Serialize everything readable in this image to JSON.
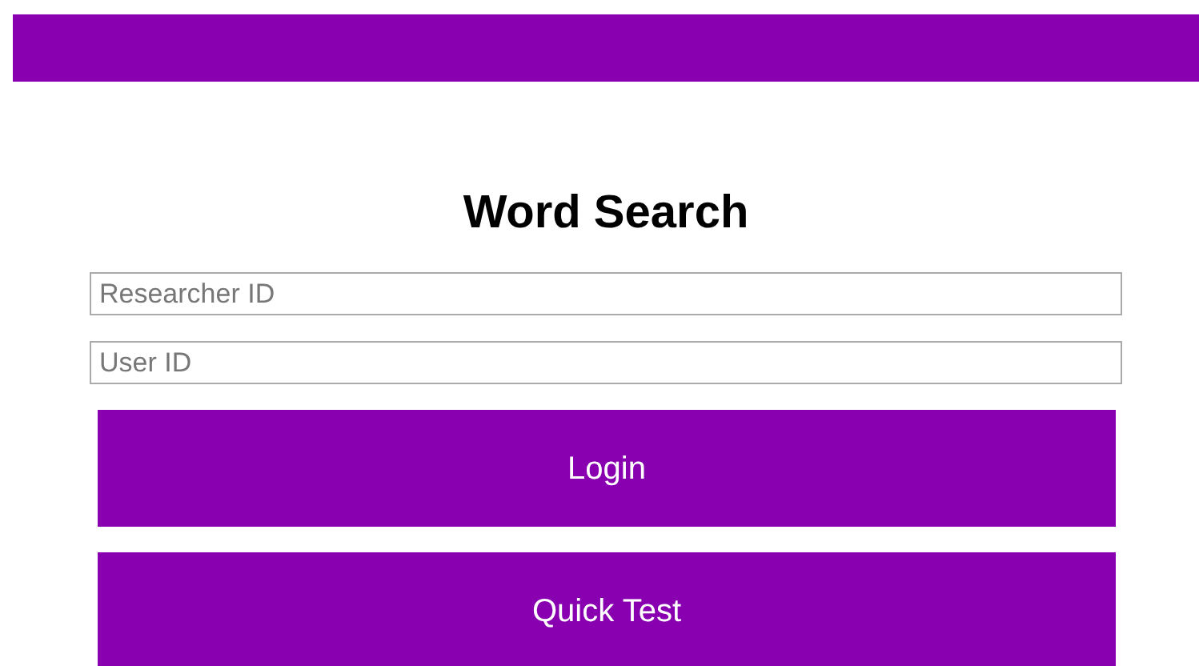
{
  "title": "Word Search",
  "fields": [
    {
      "placeholder": "Researcher ID"
    },
    {
      "placeholder": "User ID"
    }
  ],
  "buttons": [
    "Login",
    "Quick Test"
  ]
}
